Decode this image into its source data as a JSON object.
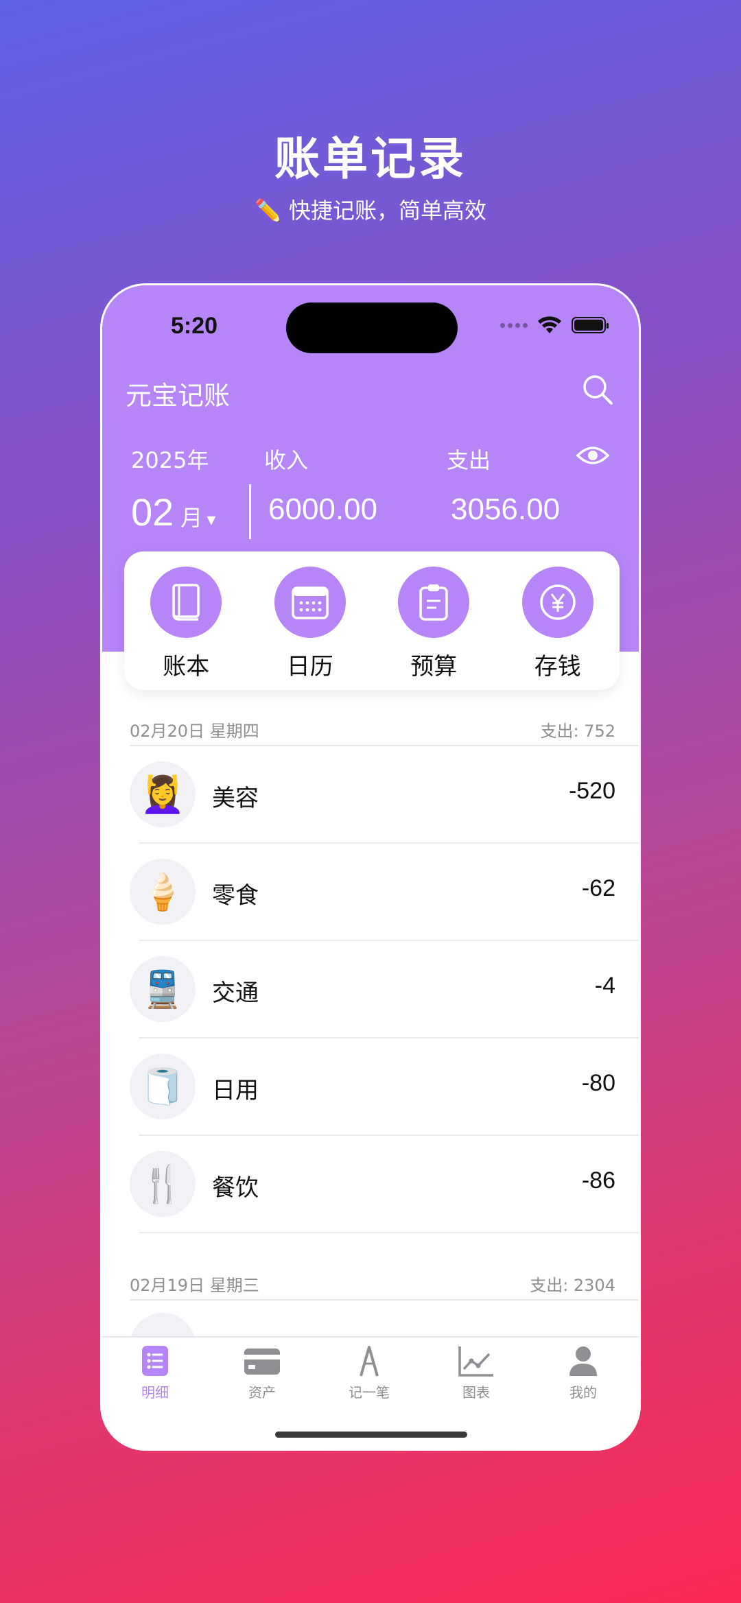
{
  "promo": {
    "title": "账单记录",
    "subtitle": "✏️ 快捷记账，简单高效"
  },
  "status_bar": {
    "time": "5:20"
  },
  "header": {
    "app_title": "元宝记账",
    "year_label": "2025年",
    "month": "02",
    "month_unit": "月",
    "month_arrow": "▾",
    "income_label": "收入",
    "expense_label": "支出",
    "income_value": "6000.00",
    "expense_value": "3056.00"
  },
  "shortcuts": [
    {
      "label": "账本",
      "icon": "book-icon"
    },
    {
      "label": "日历",
      "icon": "calendar-icon"
    },
    {
      "label": "预算",
      "icon": "clipboard-icon"
    },
    {
      "label": "存钱",
      "icon": "yen-icon"
    }
  ],
  "days": [
    {
      "date": "02月20日  星期四",
      "total": "支出: 752",
      "items": [
        {
          "emoji": "💆‍♀️",
          "name": "美容",
          "amount": "-520"
        },
        {
          "emoji": "🍦",
          "name": "零食",
          "amount": "-62"
        },
        {
          "emoji": "🚆",
          "name": "交通",
          "amount": "-4"
        },
        {
          "emoji": "🧻",
          "name": "日用",
          "amount": "-80"
        },
        {
          "emoji": "🍴",
          "name": "餐饮",
          "amount": "-86"
        }
      ]
    },
    {
      "date": "02月19日  星期三",
      "total": "支出: 2304",
      "items": []
    }
  ],
  "tabs": [
    {
      "label": "明细",
      "icon": "list-icon",
      "active": true
    },
    {
      "label": "资产",
      "icon": "card-icon",
      "active": false
    },
    {
      "label": "记一笔",
      "icon": "pen-icon",
      "active": false
    },
    {
      "label": "图表",
      "icon": "chart-icon",
      "active": false
    },
    {
      "label": "我的",
      "icon": "person-icon",
      "active": false
    }
  ],
  "colors": {
    "accent": "#b685f7",
    "text_primary": "#111111",
    "text_secondary": "#8e8e93"
  }
}
